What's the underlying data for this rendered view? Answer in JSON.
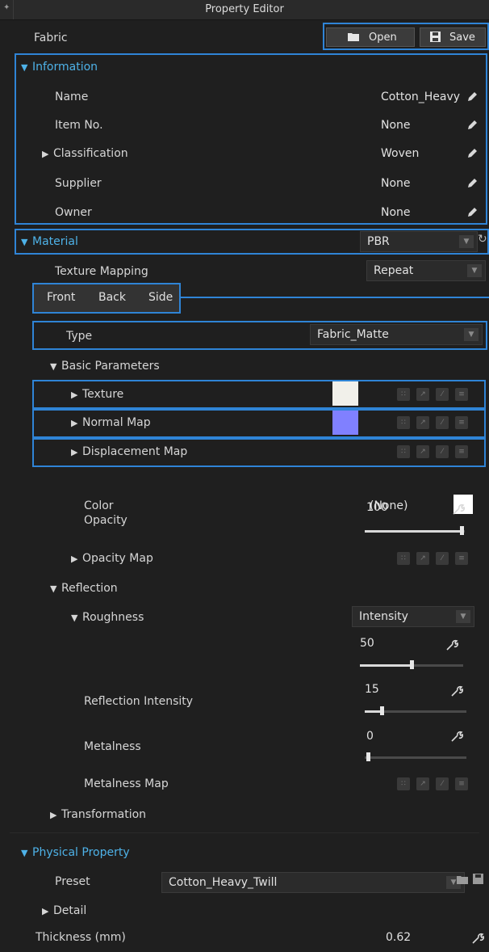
{
  "window": {
    "title": "Property Editor"
  },
  "header": {
    "label": "Fabric",
    "open_label": "Open",
    "save_label": "Save"
  },
  "information": {
    "title": "Information",
    "rows": [
      {
        "label": "Name",
        "value": "Cotton_Heavy"
      },
      {
        "label": "Item No.",
        "value": "None"
      },
      {
        "label": "Classification",
        "value": "Woven"
      },
      {
        "label": "Supplier",
        "value": "None"
      },
      {
        "label": "Owner",
        "value": "None"
      }
    ]
  },
  "material": {
    "title": "Material",
    "type_value": "PBR",
    "texture_mapping_label": "Texture Mapping",
    "texture_mapping_value": "Repeat",
    "tabs": [
      "Front",
      "Back",
      "Side"
    ],
    "type_label": "Type",
    "type_select": "Fabric_Matte",
    "basic_parameters": "Basic Parameters",
    "texture_label": "Texture",
    "texture_color": "#f1f0ea",
    "normal_map_label": "Normal Map",
    "normal_map_color": "#8080ff",
    "displacement_label": "Displacement Map",
    "color_label": "Color",
    "color_value": "(None)",
    "color_swatch": "#ffffff",
    "opacity_label": "Opacity",
    "opacity_value": "100",
    "opacity_map_label": "Opacity Map",
    "reflection": "Reflection",
    "roughness_label": "Roughness",
    "roughness_mode": "Intensity",
    "roughness_value": "50",
    "reflection_intensity_label": "Reflection Intensity",
    "reflection_intensity_value": "15",
    "metalness_label": "Metalness",
    "metalness_value": "0",
    "metalness_map_label": "Metalness Map",
    "transformation": "Transformation"
  },
  "physical": {
    "title": "Physical Property",
    "preset_label": "Preset",
    "preset_value": "Cotton_Heavy_Twill",
    "detail_label": "Detail",
    "thickness_label": "Thickness (mm)",
    "thickness_value": "0.62"
  },
  "colors": {
    "accent": "#4eb2e8",
    "highlight": "#2f84d6"
  }
}
